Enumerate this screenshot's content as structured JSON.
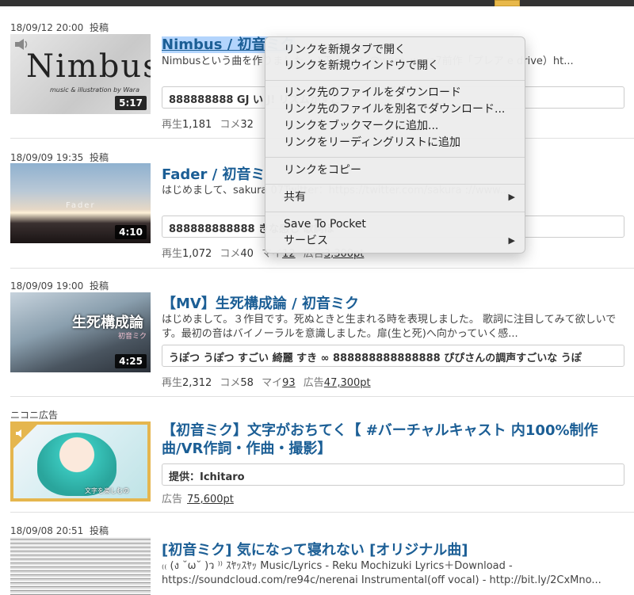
{
  "items": [
    {
      "date": "18/09/12 20:00",
      "posted": "投稿",
      "title": "Nimbus / 初音ミク",
      "desc": "Nimbusという曲を作りました。 ) Twitter：@wara_wara7前作「プレア e drive）ht...",
      "comments": "888888888 GJ い J! リズムがすごい",
      "duration": "5:17",
      "thumb_text": "Nimbus",
      "thumb_sub": "music & illustration by Wara",
      "views_label": "再生",
      "views": "1,181",
      "comments_label": "コメ",
      "comment_count": "32"
    },
    {
      "date": "18/09/09 19:35",
      "posted": "投稿",
      "title": "Fader / 初音ミ",
      "desc": "はじめまして、sakura 07Twitter：https://twitter.com/sakura ://www....",
      "comments": "888888888888 きな感じ 歌詞ほ",
      "duration": "4:10",
      "thumb_text": "Fader",
      "views_label": "再生",
      "views": "1,072",
      "comments_label": "コメ",
      "comment_count": "40",
      "mylist_label": "マイ",
      "mylist": "12",
      "ad_label": "広告",
      "ad_points": "3,300pt"
    },
    {
      "date": "18/09/09 19:00",
      "posted": "投稿",
      "title": "【MV】生死構成論 / 初音ミク",
      "desc": "はじめまして。３作目です。死ぬときと生まれる時を表現しました。 歌詞に注目してみて欲しいです。最初の音はバイノーラルを意識しました。扉(生と死)へ向かっていく感...",
      "comments": "うぽつ うぽつ すごい 綺麗 すき ∞ 888888888888888 ぴぴさんの調声すごいな うぽ",
      "duration": "4:25",
      "thumb_text": "生死構成論",
      "thumb_sub": "初音ミク",
      "views_label": "再生",
      "views": "2,312",
      "comments_label": "コメ",
      "comment_count": "58",
      "mylist_label": "マイ",
      "mylist": "93",
      "ad_label": "広告",
      "ad_points": "47,300pt"
    },
    {
      "date": "ニコニ広告",
      "title": "【初音ミク】文字がおちてく【 #バーチャルキャスト 内100%制作曲/VR作詞・作曲・撮影】",
      "provider": "提供：Ichitaro",
      "thumb_caption": "文字を楽しむの",
      "ad_label": "広告",
      "ad_points": "75,600pt"
    },
    {
      "date": "18/09/08 20:51",
      "posted": "投稿",
      "title": "[初音ミク] 気になって寝れない [オリジナル曲]",
      "desc": "₍₍ (ง ˘ω˘ )ว ⁾⁾ ｽﾔｯｽﾔｯ Music/Lyrics - Reku Mochizuki Lyrics＋Download - https://soundcloud.com/re94c/nerenai Instrumental(off vocal) - http://bit.ly/2CxMno..."
    }
  ],
  "context_menu": {
    "groups": [
      [
        "リンクを新規タブで開く",
        "リンクを新規ウインドウで開く"
      ],
      [
        "リンク先のファイルをダウンロード",
        "リンク先のファイルを別名でダウンロード...",
        "リンクをブックマークに追加...",
        "リンクをリーディングリストに追加"
      ],
      [
        "リンクをコピー"
      ],
      [
        "共有"
      ],
      [
        "Save To Pocket",
        "サービス"
      ]
    ]
  },
  "colors": {
    "title": "#1b5e95",
    "ad_border": "#e5b64e",
    "selection": "#b3d4fc"
  }
}
